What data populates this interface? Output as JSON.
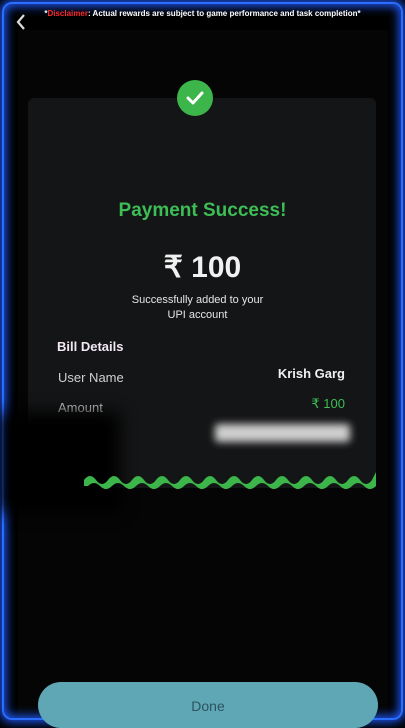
{
  "disclaimer": {
    "prefix": "*",
    "highlight": "Disclaimer",
    "rest": ": Actual rewards are subject to game performance and task completion*"
  },
  "status": {
    "title": "Payment Success!",
    "amount": "₹ 100",
    "message_line1": "Successfully added to your",
    "message_line2": "UPI account"
  },
  "bill": {
    "heading": "Bill Details",
    "rows": [
      {
        "label": "User Name",
        "value": "Krish Garg"
      },
      {
        "label": "Amount",
        "value": "₹ 100"
      }
    ]
  },
  "done_button": {
    "label": "Done"
  },
  "colors": {
    "success": "#3cb64a",
    "accent_border": "#2b6dff",
    "disclaimer_highlight": "#ff2a2a"
  },
  "icons": {
    "back": "chevron-left-icon",
    "success": "check-circle-icon"
  }
}
